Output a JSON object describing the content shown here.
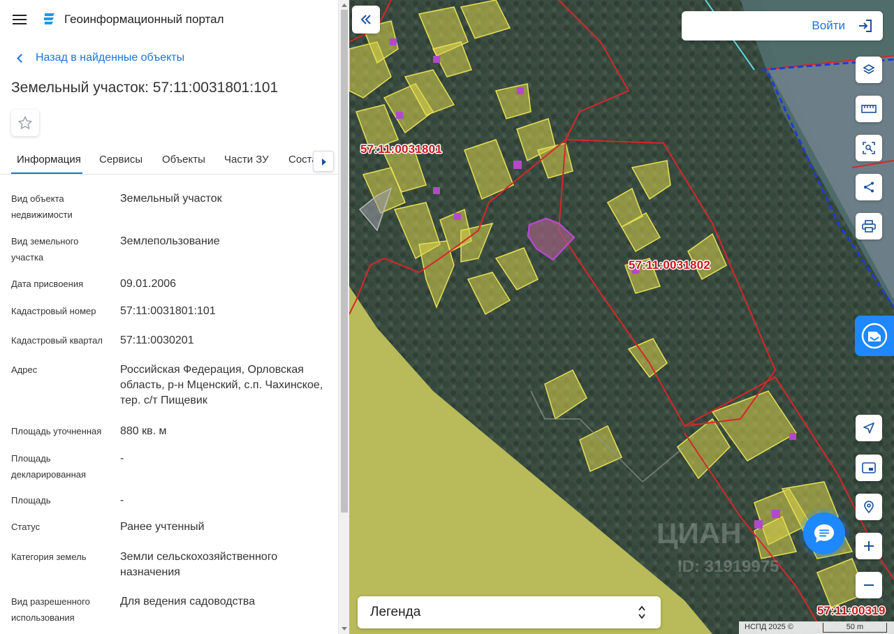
{
  "header": {
    "app_title": "Геоинформационный портал",
    "menu_icon": "hamburger-icon",
    "logo_icon": "portal-logo-icon"
  },
  "back_link": {
    "label": "Назад в найденные объекты"
  },
  "object": {
    "title": "Земельный участок: 57:11:0031801:101"
  },
  "tabs": [
    {
      "label": "Информация",
      "active": true
    },
    {
      "label": "Сервисы"
    },
    {
      "label": "Объекты"
    },
    {
      "label": "Части ЗУ"
    },
    {
      "label": "Соста"
    }
  ],
  "properties": [
    {
      "key": "Вид объекта недвижимости",
      "value": "Земельный участок"
    },
    {
      "key": "Вид земельного участка",
      "value": "Землепользование"
    },
    {
      "key": "Дата присвоения",
      "value": "09.01.2006"
    },
    {
      "key": "Кадастровый номер",
      "value": "57:11:0031801:101"
    },
    {
      "key": "Кадастровый квартал",
      "value": "57:11:0030201"
    },
    {
      "key": "Адрес",
      "value": "Российская Федерация, Орловская область, р-н Мценский, с.п. Чахинское, тер. с/т Пищевик"
    },
    {
      "key": "Площадь уточненная",
      "value": "880 кв. м"
    },
    {
      "key": "Площадь декларированная",
      "value": "-"
    },
    {
      "key": "Площадь",
      "value": "-"
    },
    {
      "key": "Статус",
      "value": "Ранее учтенный"
    },
    {
      "key": "Категория земель",
      "value": "Земли сельскохозяйственного назначения"
    },
    {
      "key": "Вид разрешенного использования",
      "value": "Для ведения садоводства"
    }
  ],
  "map": {
    "login_label": "Войти",
    "legend_label": "Легенда",
    "cadastral_labels": [
      "57:11:0031801",
      "57:11:0031802",
      "57:11:00319"
    ],
    "attribution": "НСПД 2025 ©",
    "scale": "50 m",
    "watermark": "ЦИАН",
    "watermark_id": "ID: 31919975"
  },
  "colors": {
    "accent": "#1a73d9",
    "boundary": "#d8262a",
    "parcel_fill": "#d9d24a",
    "selected_parcel": "#a23cc8",
    "chat": "#1e88ff"
  }
}
